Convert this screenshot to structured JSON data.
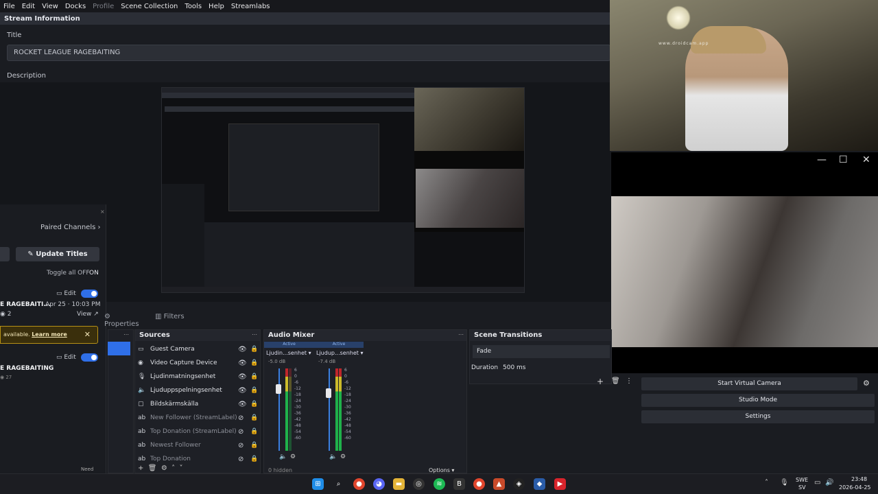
{
  "menubar": {
    "items": [
      "File",
      "Edit",
      "View",
      "Docks",
      "Profile",
      "Scene Collection",
      "Tools",
      "Help",
      "Streamlabs"
    ]
  },
  "stream_info": {
    "header": "Stream Information",
    "title_label": "Title",
    "title_value": "ROCKET LEAGUE RAGEBAITING",
    "description_label": "Description"
  },
  "webcam": {
    "watermark": "www.droidcam.app"
  },
  "left_panel": {
    "paired_channels": "Paired Channels",
    "update_titles": "Update Titles",
    "toggle_all": "Toggle all OFF",
    "toggle_on": "ON",
    "item1": {
      "edit": "Edit",
      "title": "E RAGEBAITI...",
      "date": "Apr 25 · 10:03 PM",
      "count": "2",
      "view": "View"
    },
    "warning": {
      "text": "available.",
      "link": "Learn more"
    },
    "item2": {
      "edit": "Edit",
      "title": "E RAGEBAITING",
      "count": "27"
    },
    "need": "Need"
  },
  "tabs": {
    "properties": "Properties",
    "filters": "Filters"
  },
  "sources": {
    "title": "Sources",
    "items": [
      {
        "icon": "camera-icon",
        "name": "Guest Camera"
      },
      {
        "icon": "capture-icon",
        "name": "Video Capture Device"
      },
      {
        "icon": "mic-icon",
        "name": "Ljudinmatningsenhet"
      },
      {
        "icon": "speaker-icon",
        "name": "Ljuduppspelningsenhet"
      },
      {
        "icon": "monitor-icon",
        "name": "Bildskärmskälla"
      },
      {
        "icon": "ab-icon",
        "name": "New Follower (StreamLabel)"
      },
      {
        "icon": "ab-icon",
        "name": "Top Donation (StreamLabel)"
      },
      {
        "icon": "ab-icon",
        "name": "Newest Follower"
      },
      {
        "icon": "ab-icon",
        "name": "Top Donation"
      }
    ]
  },
  "mixer": {
    "title": "Audio Mixer",
    "channels": [
      {
        "status": "Active",
        "name": "Ljudin...senhet",
        "db": "-5.0 dB",
        "level": 0.62
      },
      {
        "status": "Active",
        "name": "Ljudup...senhet",
        "db": "-7.4 dB",
        "level": 0.55
      }
    ],
    "scale": [
      "6",
      "0",
      "-6",
      "-12",
      "-18",
      "-24",
      "-30",
      "-36",
      "-42",
      "-48",
      "-54",
      "-60"
    ],
    "footer_hidden": "0 hidden",
    "options": "Options"
  },
  "transitions": {
    "title": "Scene Transitions",
    "type": "Fade",
    "duration_label": "Duration",
    "duration_value": "500 ms"
  },
  "controls": {
    "virtual_camera": "Start Virtual Camera",
    "studio_mode": "Studio Mode",
    "settings": "Settings"
  },
  "taskbar": {
    "lang1": "SWE",
    "lang2": "SV",
    "time": "23:48",
    "date": "2026-04-25"
  },
  "colors": {
    "accent": "#2f6fe8",
    "active": "#3a7fe0",
    "warning_border": "#b89216"
  }
}
